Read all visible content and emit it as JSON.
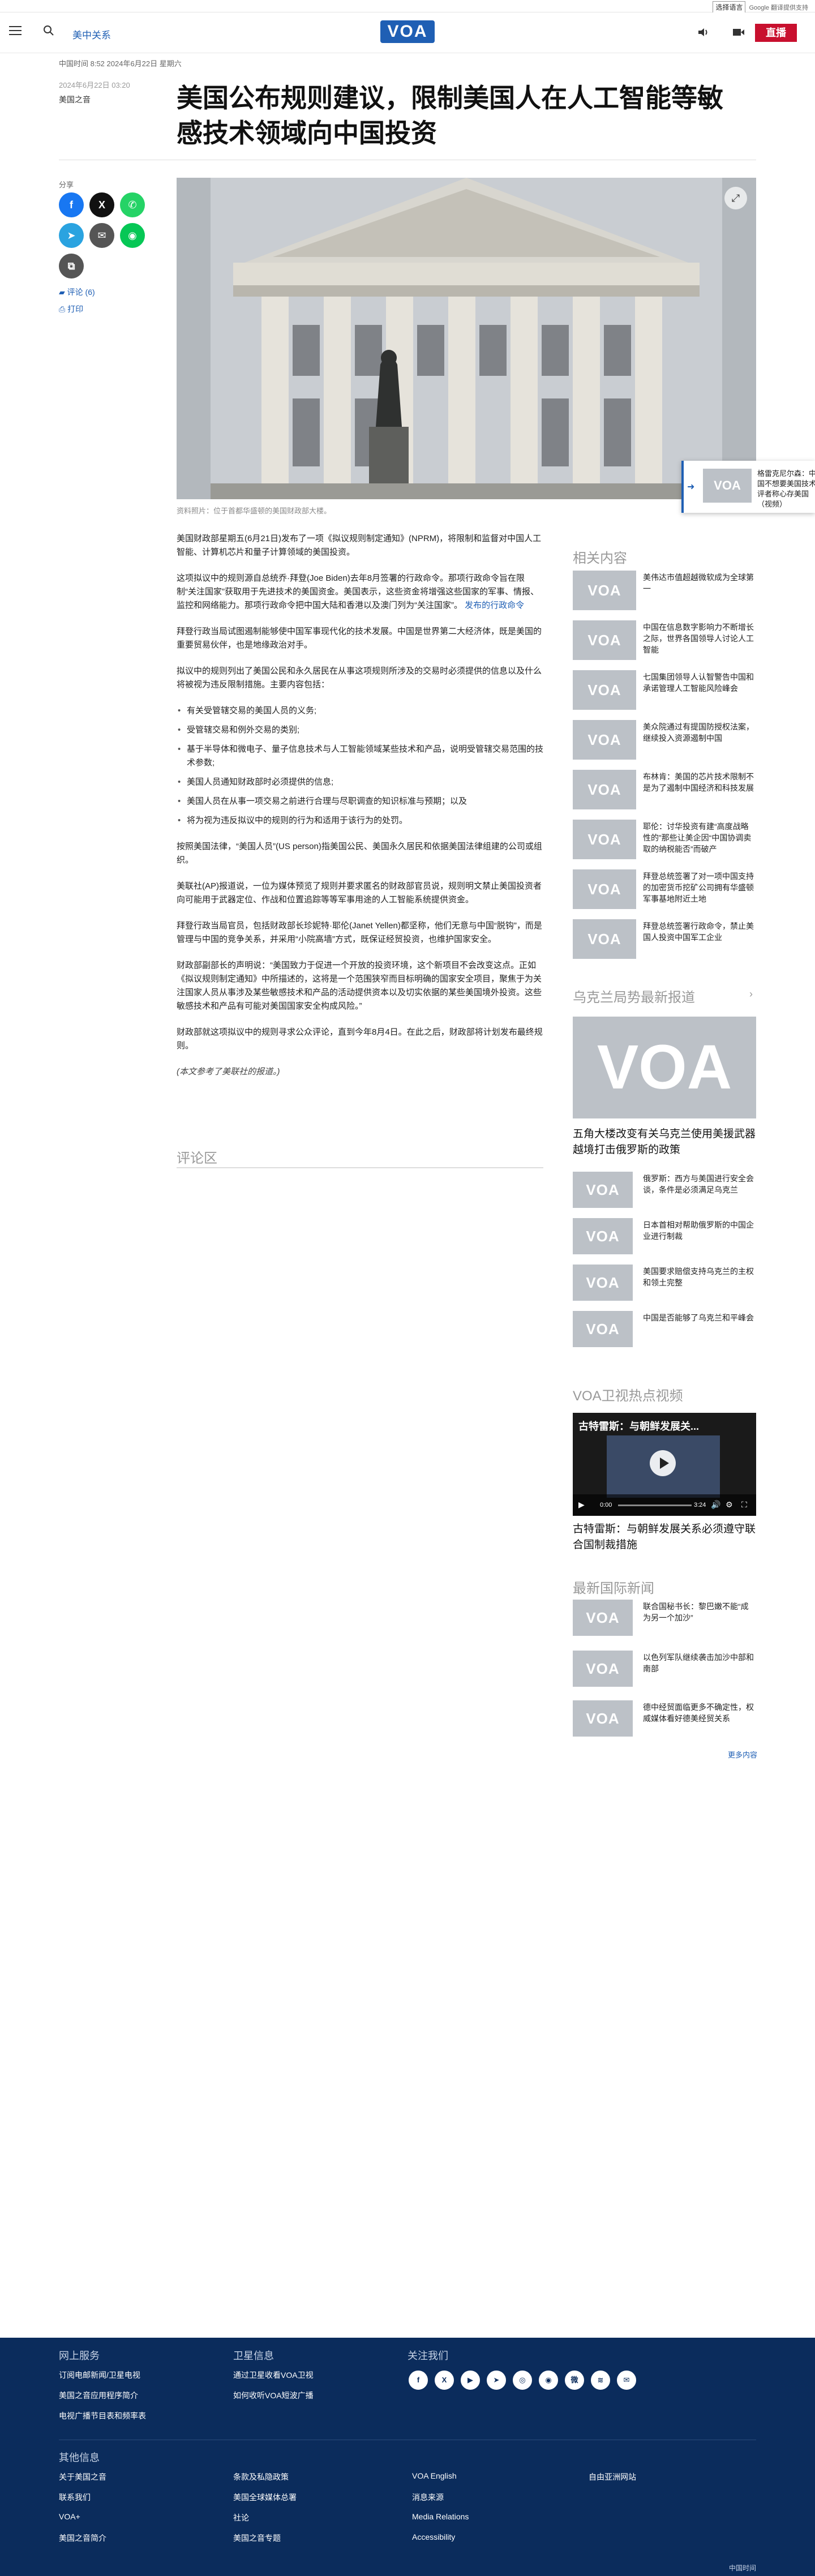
{
  "translate": {
    "select_label": "选择语言",
    "powered": "Google 翻译提供支持"
  },
  "nav": {
    "section": "美中关系",
    "live": "直播",
    "logo": "VOA"
  },
  "article": {
    "meta": "中国时间 8:52 2024年6月22日 星期六",
    "sub_meta": "2024年6月22日 03:20",
    "author": "美国之音",
    "title": "美国公布规则建议，限制美国人在人工智能等敏感技术领域向中国投资",
    "caption": "资料照片：位于首都华盛顿的美国财政部大楼。",
    "paragraphs": [
      "美国财政部星期五(6月21日)发布了一项《拟议规则制定通知》(NPRM)，将限制和监督对中国人工智能、计算机芯片和量子计算领域的美国投资。",
      "这项拟议中的规则源自总统乔·拜登(Joe Biden)去年8月签署的行政命令。那项行政命令旨在限制“关注国家”获取用于先进技术的美国资金。美国表示，这些资金将增强这些国家的军事、情报、监控和网络能力。那项行政命令把中国大陆和香港以及澳门列为“关注国家”。",
      "拜登行政当局试图遏制能够使中国军事现代化的技术发展。中国是世界第二大经济体，既是美国的重要贸易伙伴，也是地缘政治对手。",
      "拟议中的规则列出了美国公民和永久居民在从事这项规则所涉及的交易时必须提供的信息以及什么将被视为违反限制措施。主要内容包括："
    ],
    "link_text": "发布的行政命令",
    "bullets": [
      "有关受管辖交易的美国人员的义务;",
      "受管辖交易和例外交易的类别;",
      "基于半导体和微电子、量子信息技术与人工智能领域某些技术和产品，说明受管辖交易范围的技术参数;",
      "美国人员通知财政部时必须提供的信息;",
      "美国人员在从事一项交易之前进行合理与尽职调查的知识标准与预期；以及",
      "将为视为违反拟议中的规则的行为和适用于该行为的处罚。"
    ],
    "paragraphs2": [
      "按照美国法律，“美国人员”(US person)指美国公民、美国永久居民和依据美国法律组建的公司或组织。",
      "美联社(AP)报道说，一位为媒体预览了规则并要求匿名的财政部官员说，规则明文禁止美国投资者向可能用于武器定位、作战和位置追踪等等军事用途的人工智能系统提供资金。",
      "拜登行政当局官员，包括财政部长珍妮特·耶伦(Janet Yellen)都坚称，他们无意与中国“脱钩”，而是管理与中国的竞争关系，并采用“小院高墙”方式，既保证经贸投资，也维护国家安全。",
      "财政部副部长的声明说：“美国致力于促进一个开放的投资环境，这个新项目不会改变这点。正如《拟议规则制定通知》中所描述的，这将是一个范围狭窄而目标明确的国家安全项目，聚焦于为关注国家人员从事涉及某些敏感技术和产品的活动提供资本以及切实依据的某些美国境外投资。这些敏感技术和产品有可能对美国国家安全构成风险。”",
      "财政部就这项拟议中的规则寻求公众评论，直到今年8月4日。在此之后，财政部将计划发布最终规则。"
    ],
    "editor_note": "(本文参考了美联社的报道。)",
    "comments": "评论区"
  },
  "share": {
    "label": "分享",
    "comments_link": "评论 (6)",
    "print_link": "打印"
  },
  "popup": {
    "text": "格雷克尼尔森：中国不想要美国技术评者称心存美国（视频）"
  },
  "related": {
    "heading": "相关内容",
    "items": [
      "美伟达市值超越微软成为全球第一",
      "中国在信息数字影响力不断增长之际，世界各国领导人讨论人工智能",
      "七国集团领导人认智警告中国和承诺管理人工智能风险峰会",
      "美众院通过有提国防授权法案，继续投入资源遏制中国",
      "布林肯：美国的芯片技术限制不是为了遏制中国经济和科技发展",
      "耶伦：讨华投资有建“高度战略性的”那些让美企因“中国协调卖取的纳税能否”而破产",
      "拜登总统签署了对一项中国支持的加密货币挖矿公司拥有华盛顿军事基地附近土地",
      "拜登总统签署行政命令，禁止美国人投资中国军工企业"
    ]
  },
  "ukraine": {
    "heading": "乌克兰局势最新报道",
    "big_caption": "五角大楼改变有关乌克兰使用美援武器越境打击俄罗斯的政策",
    "items": [
      "俄罗斯：西方与美国进行安全会谈，条件是必须满足乌克兰",
      "日本首相对帮助俄罗斯的中国企业进行制裁",
      "美国要求赔偿支持乌克兰的主权和领土完整",
      "中国是否能够了乌克兰和平峰会"
    ]
  },
  "video": {
    "heading": "VOA卫视热点视频",
    "title_overlay": "古特雷斯：与朝鲜发展关...",
    "time": "0:00",
    "duration": "3:24",
    "caption": "古特雷斯：与朝鲜发展关系必须遵守联合国制裁措施"
  },
  "intl": {
    "heading": "最新国际新闻",
    "items": [
      "联合国秘书长：黎巴嫩不能“成为另一个加沙”",
      "以色列军队继续袭击加沙中部和南部",
      "德中经贸面临更多不确定性，权威媒体看好德美经贸关系"
    ],
    "more": "更多内容"
  },
  "footer": {
    "col1": {
      "head": "网上服务",
      "links": [
        "订阅电邮新闻/卫星电视",
        "美国之音应用程序简介",
        "电视广播节目表和频率表"
      ]
    },
    "col2": {
      "head": "卫星信息",
      "links": [
        "通过卫星收看VOA卫视",
        "如何收听VOA短波广播"
      ]
    },
    "col3": {
      "head": "关注我们"
    },
    "other_head": "其他信息",
    "other": [
      [
        "关于美国之音",
        "条款及私隐政策",
        "VOA English",
        "自由亚洲网站"
      ],
      [
        "联系我们",
        "美国全球媒体总署",
        "消息来源"
      ],
      [
        "VOA+",
        "社论",
        "Media Relations"
      ],
      [
        "美国之音简介",
        "美国之音专题",
        "Accessibility"
      ]
    ],
    "copyright": "中国时间"
  },
  "colors": {
    "brand": "#1f5fb4",
    "live": "#c8102e",
    "footer": "#0b2c5c"
  },
  "icons": [
    "menu-icon",
    "search-icon",
    "speaker-icon",
    "video-icon",
    "facebook-icon",
    "x-icon",
    "whatsapp-icon",
    "telegram-icon",
    "email-icon",
    "line-icon",
    "copy-icon",
    "comment-icon",
    "print-icon",
    "expand-icon"
  ]
}
